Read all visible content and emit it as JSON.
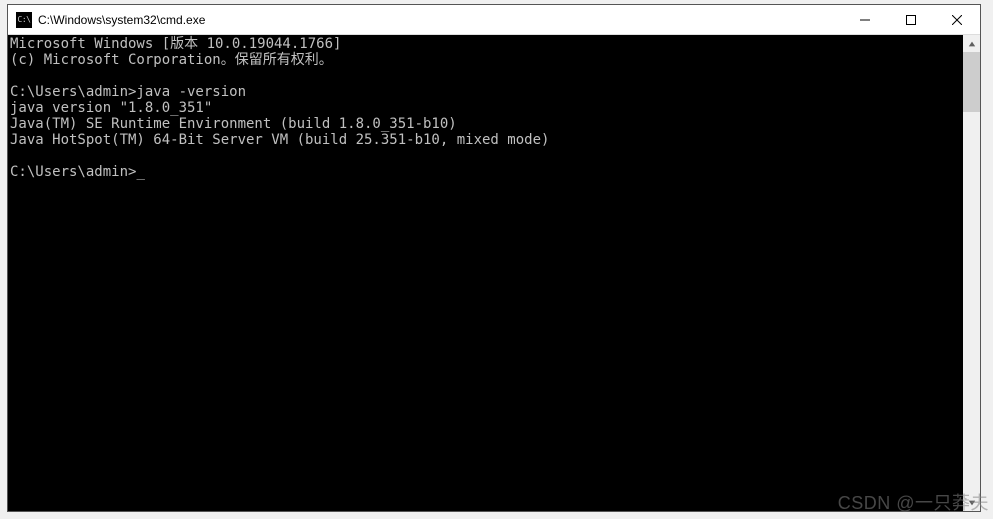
{
  "window": {
    "icon_text": "C:\\",
    "title": "C:\\Windows\\system32\\cmd.exe"
  },
  "console": {
    "lines": [
      "Microsoft Windows [版本 10.0.19044.1766]",
      "(c) Microsoft Corporation。保留所有权利。",
      "",
      "C:\\Users\\admin>java -version",
      "java version \"1.8.0_351\"",
      "Java(TM) SE Runtime Environment (build 1.8.0_351-b10)",
      "Java HotSpot(TM) 64-Bit Server VM (build 25.351-b10, mixed mode)",
      "",
      "C:\\Users\\admin>"
    ],
    "cursor": "_"
  },
  "watermark": "CSDN @一只莽夫"
}
